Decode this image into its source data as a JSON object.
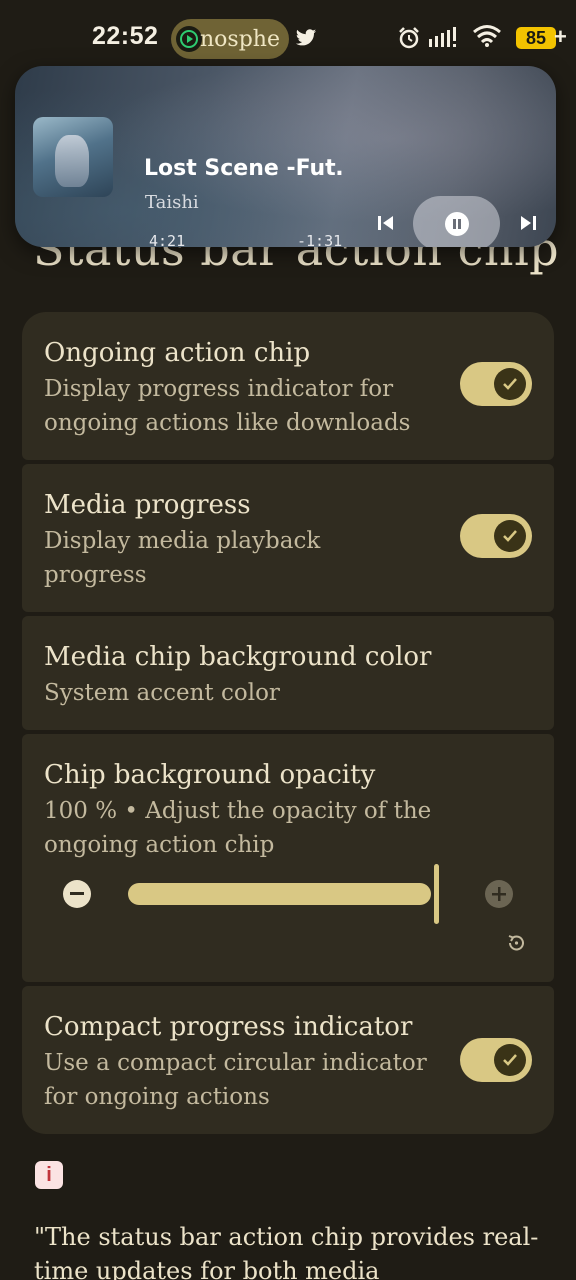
{
  "status_bar": {
    "time": "22:52",
    "app_chip_text": "nosphe",
    "battery": "85",
    "battery_suffix": "+",
    "icons": [
      "twitter-icon",
      "alarm-icon",
      "signal-icon",
      "wifi-icon",
      "battery-icon"
    ]
  },
  "media": {
    "title": "Lost Scene -Fut…",
    "artist": "Taishi",
    "elapsed": "4:21",
    "remaining": "-1:31",
    "progress_fraction": 0.74,
    "controls": [
      "previous-icon",
      "pause-icon",
      "next-icon"
    ]
  },
  "page": {
    "title": "Status bar action chip"
  },
  "settings": {
    "ongoing_chip": {
      "title": "Ongoing action chip",
      "desc_line1": "Display progress indicator for",
      "desc_line2": "ongoing actions like downloads",
      "enabled": true
    },
    "media_progress": {
      "title": "Media progress",
      "desc_line1": "Display media playback",
      "desc_line2": "progress",
      "enabled": true
    },
    "media_chip_bg": {
      "title": "Media chip background color",
      "desc": "System accent color"
    },
    "chip_opacity": {
      "title": "Chip background opacity",
      "desc_line1": "100 % • Adjust the opacity of the",
      "desc_line2": "ongoing action chip",
      "value_percent": 100
    },
    "compact_indicator": {
      "title": "Compact progress indicator",
      "desc_line1": "Use a compact circular indicator",
      "desc_line2": "for ongoing actions",
      "enabled": true
    }
  },
  "footer": {
    "info_icon": "i",
    "text": "\"The status bar action chip provides real-time updates for both media"
  },
  "colors": {
    "background": "#1f1c15",
    "card": "#302c20",
    "accent": "#d9c884",
    "battery": "#f3c300"
  }
}
